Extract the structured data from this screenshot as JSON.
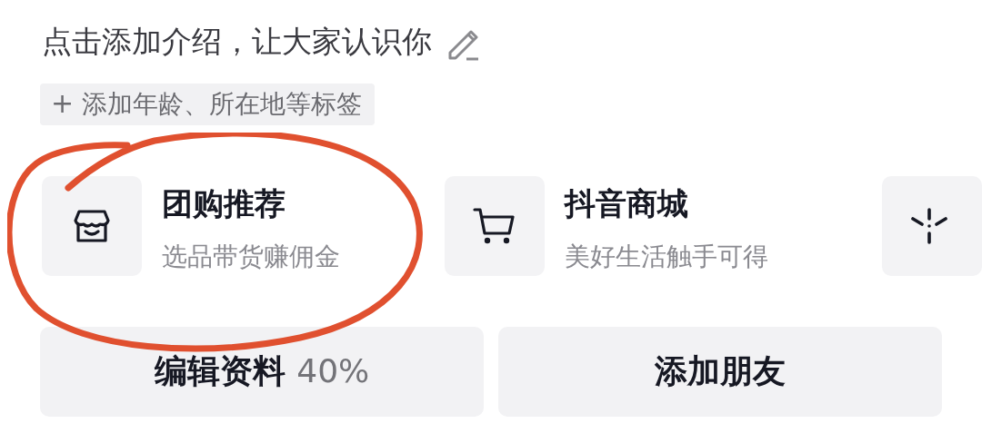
{
  "bio": {
    "text": "点击添加介绍，让大家认识你"
  },
  "tag_chip": {
    "icon": "+",
    "label": "添加年龄、所在地等标签"
  },
  "services": [
    {
      "title": "团购推荐",
      "subtitle": "选品带货赚佣金"
    },
    {
      "title": "抖音商城",
      "subtitle": "美好生活触手可得"
    }
  ],
  "buttons": {
    "edit_profile": {
      "label": "编辑资料",
      "progress": "40%"
    },
    "add_friends": {
      "label": "添加朋友"
    }
  }
}
